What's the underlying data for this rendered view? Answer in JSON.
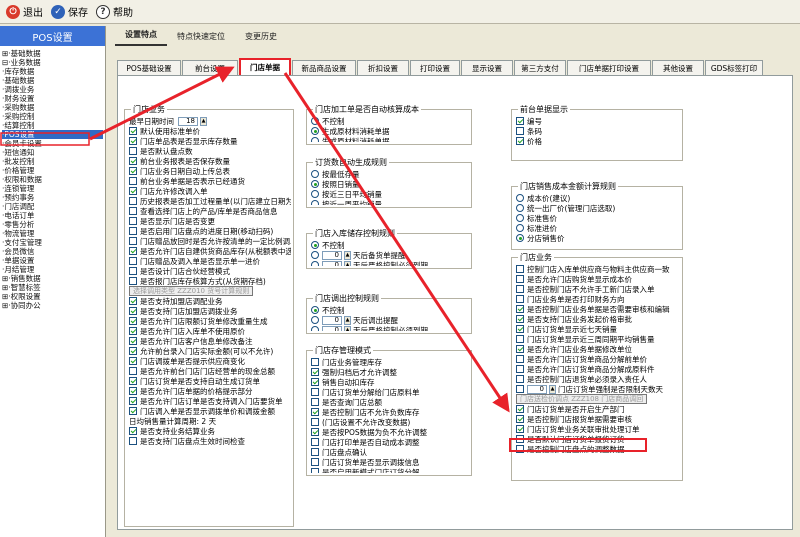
{
  "toolbar": {
    "exit": "退出",
    "save": "保存",
    "help": "帮助"
  },
  "left": {
    "title": "POS设置",
    "items": [
      "⊞·基础数据",
      "⊟·业务数据",
      "  ·库存数据",
      "  ·基础数据",
      "  ·调拨业务",
      "  ·财务设置",
      "  ·采购数据",
      "  ·采购控制",
      "  ·结算控制",
      "  ·POS设置",
      "  ·会员卡设置",
      "  ·短信通知",
      "  ·批发控制",
      "  ·价格管理",
      "  ·权限和数据",
      "  ·连锁管理",
      "  ·预约事务",
      "  ·门店调配",
      "  ·电话订单",
      "  ·零售分析",
      "  ·物流管理",
      "  ·支付宝管理",
      "  ·会员微信",
      "  ·单据设置",
      "  ·月结管理",
      "⊞·销售数据",
      "⊞·智慧标签",
      "⊞·权限设置",
      "⊞·协同办公"
    ]
  },
  "tabs": {
    "top": [
      "设置特点",
      "特点快速定位",
      "变更历史"
    ],
    "sub": [
      "POS基础设置",
      "前台设置",
      "门店单据",
      "新品商品设置",
      "折扣设置",
      "打印设置",
      "显示设置",
      "第三方支付",
      "门店单据打印设置",
      "其他设置",
      "GDS标签打印"
    ]
  },
  "g1": {
    "title": "门店业务",
    "rows": [
      {
        "t": "最早日期时间",
        "v": "18",
        "type": "num"
      },
      {
        "t": "默认使用标准单价",
        "on": true
      },
      {
        "t": "门店单品表是否显示库存数量",
        "on": true
      },
      {
        "t": "是否默认盘点数",
        "on": false
      },
      {
        "t": "前台业务报表是否保存数量",
        "on": true
      },
      {
        "t": "门店业务日期自动上传总表",
        "on": true
      },
      {
        "t": "前台业务单据是否表示已经通货",
        "on": false
      },
      {
        "t": "门店允许修改调入单",
        "on": true
      },
      {
        "t": "历史报表是否加工过程量单(以门店建立日期为准)",
        "on": false
      },
      {
        "t": "查看选择门店上的产品/库单是否商品信息",
        "on": false
      },
      {
        "t": "是否显示门店是否变更",
        "on": false
      },
      {
        "t": "是否启用门店盘点的进度日期(移动扫码)",
        "on": false
      },
      {
        "t": "门店赠品放回时是否允许按清单的一定比例调单",
        "on": false
      },
      {
        "t": "是否允许门店自建供货商品库存(从税额表中选取)",
        "on": true
      },
      {
        "t": "门店赠品及调入单是否显示单一进价",
        "on": false
      },
      {
        "t": "是否设计门店合伙经营模式",
        "on": false
      },
      {
        "t": "是否报门店库存核算方式(从货期存档)",
        "on": false
      },
      {
        "t": "选择调用类型  ZZZ010  货号计算规则",
        "type": "gray"
      },
      {
        "t": "是否支持加盟店调配业务",
        "on": true
      },
      {
        "t": "是否支持门店加盟店调拨业务",
        "on": true
      },
      {
        "t": "是否允许门店限额订货单修改重量生成",
        "on": true
      },
      {
        "t": "是否允许门店入库单不使用原价",
        "on": true
      },
      {
        "t": "是否允许门店客户信息单修改备注",
        "on": true
      },
      {
        "t": "允许前台录入门店实际金额(可以不允许)",
        "on": true
      },
      {
        "t": "门店调拨单是否提示供应商变化",
        "on": true
      },
      {
        "t": "是否允许前台门店门店经营单的现金总额",
        "on": false
      },
      {
        "t": "门店订货单是否支持自动生成订货单",
        "on": true
      },
      {
        "t": "是否允许门店单据的价格提示部分",
        "on": true
      },
      {
        "t": "是否允许门店订单是否支持调入门店要货单",
        "on": true
      },
      {
        "t": "门店调入单是否显示调拨单价和调拨金额",
        "on": true
      },
      {
        "t": "日均销售量计算周期: 2  天",
        "type": "num2"
      },
      {
        "t": "是否支持业务结算业务",
        "on": true
      },
      {
        "t": "是否支持门店盘点生效时间检查",
        "on": false
      }
    ]
  },
  "g2": {
    "title": "门店加工单是否自动核算成本",
    "rows": [
      {
        "t": "不控制",
        "on": false
      },
      {
        "t": "生成原材料消耗单据",
        "on": true
      },
      {
        "t": "生成原材料消耗单据",
        "on": false
      }
    ]
  },
  "g3": {
    "title": "订货数自动生成规则",
    "rows": [
      {
        "t": "按最低存量",
        "on": false
      },
      {
        "t": "按照日销量",
        "on": true
      },
      {
        "t": "按近三日平均销量",
        "on": false
      },
      {
        "t": "按近一周平均销量",
        "on": false
      }
    ]
  },
  "g4": {
    "title": "门店入库储存控制规则",
    "rows": [
      {
        "t": "不控制",
        "on": true
      },
      {
        "t": "天后备货单提醒",
        "on": false,
        "n": "0"
      },
      {
        "t": "天后严格控制必须到期",
        "on": false,
        "n": "0"
      }
    ]
  },
  "g5": {
    "title": "门店调出控制规则",
    "rows": [
      {
        "t": "不控制",
        "on": true
      },
      {
        "t": "天后调出提醒",
        "on": false,
        "n": "0"
      },
      {
        "t": "天后严格控制必须到期",
        "on": false,
        "n": "0"
      }
    ]
  },
  "g6": {
    "title": "门店存管理模式",
    "rows": [
      {
        "t": "门店业务管理库存",
        "on": false
      },
      {
        "t": "强制归档后才允许调整",
        "on": true
      },
      {
        "t": "销售自动扣库存",
        "on": true
      },
      {
        "t": "门店订货单分解给门店原料单",
        "on": false
      },
      {
        "t": "是否查询门店总额",
        "on": false
      },
      {
        "t": "是否控制门店不允许负数库存",
        "on": true
      },
      {
        "t": "(门店设置不允许改变数据)",
        "on": false
      },
      {
        "t": "是否按POS数据为负不允许调整",
        "on": true
      },
      {
        "t": "门店打印单是否自动成本调整",
        "on": false
      },
      {
        "t": "门店盘点确认",
        "on": false
      },
      {
        "t": "门店订货单是否显示调拨信息",
        "on": false
      },
      {
        "t": "是否启用新模式门店订货分解",
        "on": false
      }
    ]
  },
  "g7": {
    "title": "前台单据显示",
    "rows": [
      {
        "t": "编号",
        "on": true
      },
      {
        "t": "条码",
        "on": false
      },
      {
        "t": "价格",
        "on": true
      }
    ]
  },
  "g8": {
    "title": "门店销售成本金额计算规则",
    "rows": [
      {
        "t": "成本价(建议)",
        "on": false
      },
      {
        "t": "统一出厂价(管理门店选取)",
        "on": false
      },
      {
        "t": "标准售价",
        "on": false
      },
      {
        "t": "标准进价",
        "on": false
      },
      {
        "t": "分店销售价",
        "on": true
      }
    ]
  },
  "g9": {
    "title": "门店业务",
    "rows": [
      {
        "t": "控制门店入库单供应商与物料主供应商一致",
        "on": false
      },
      {
        "t": "是否允许门店购货单显示成本价",
        "on": false
      },
      {
        "t": "是否控制门店不允许手工新门店录入单",
        "on": false
      },
      {
        "t": "门店业务单是否打印财务方向",
        "on": false
      },
      {
        "t": "是否控制门店业务单据是否需要审核和编辑",
        "on": true
      },
      {
        "t": "是否支持门店业务发起价格审批",
        "on": true
      },
      {
        "t": "门店订货单显示近七天销量",
        "on": true
      },
      {
        "t": "门店订货单显示近三周同期平均销售量",
        "on": false
      },
      {
        "t": "是否允许门店业务单据修改单位",
        "on": true
      },
      {
        "t": "是否允许门店订货单商品分解前单价",
        "on": false
      },
      {
        "t": "是否允许门店订货单商品分解成原料件",
        "on": false
      },
      {
        "t": "是否控制门店退货单必须录入责任人",
        "on": false
      },
      {
        "t": "门店订货单强制是否限制天数",
        "on": false,
        "n": "0",
        "suf": "天"
      },
      {
        "t": "门店送检价调点 ZZZ108 门店商品调回",
        "type": "gray"
      },
      {
        "t": "门店订货单是否开启生产部门",
        "on": true
      },
      {
        "t": "是否控制门店报货单据需要审核",
        "on": true
      },
      {
        "t": "门店订货单业务关联审批处理订单",
        "on": true
      },
      {
        "t": "是否默认门店订货单报货订货",
        "on": false
      },
      {
        "t": "是否控制门店盘点的调整数据",
        "on": false
      }
    ]
  }
}
